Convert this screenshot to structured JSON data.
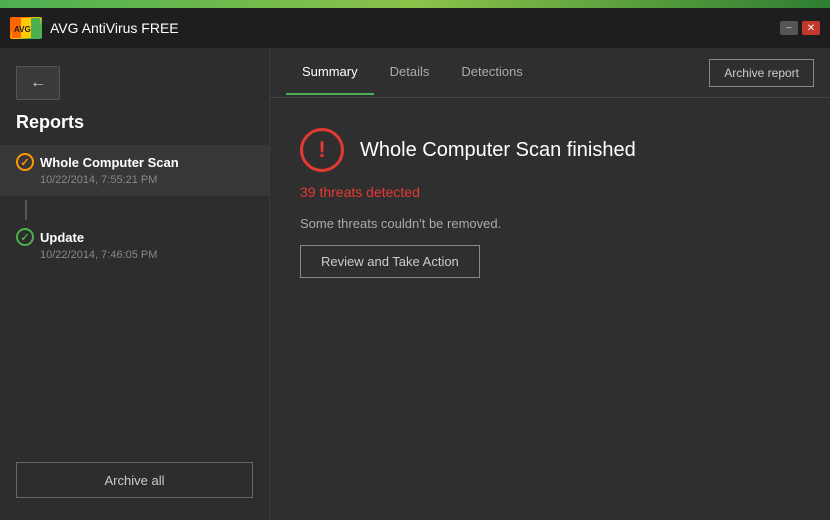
{
  "titleBar": {
    "appName": "AVG  AntiVirus FREE",
    "logoText": "AVG",
    "minimizeLabel": "−",
    "closeLabel": "✕"
  },
  "sidebar": {
    "backArrow": "←",
    "title": "Reports",
    "items": [
      {
        "name": "Whole Computer Scan",
        "date": "10/22/2014, 7:55:21 PM",
        "active": true,
        "iconType": "warning"
      },
      {
        "name": "Update",
        "date": "10/22/2014, 7:46:05 PM",
        "active": false,
        "iconType": "ok"
      }
    ],
    "archiveAllLabel": "Archive all"
  },
  "rightPanel": {
    "tabs": [
      {
        "label": "Summary",
        "active": true
      },
      {
        "label": "Details",
        "active": false
      },
      {
        "label": "Detections",
        "active": false
      }
    ],
    "archiveReportLabel": "Archive report",
    "scanTitle": "Whole Computer Scan finished",
    "threatsCount": "39 threats detected",
    "cantRemoveText": "Some threats couldn't be removed.",
    "reviewButtonLabel": "Review and Take Action"
  }
}
